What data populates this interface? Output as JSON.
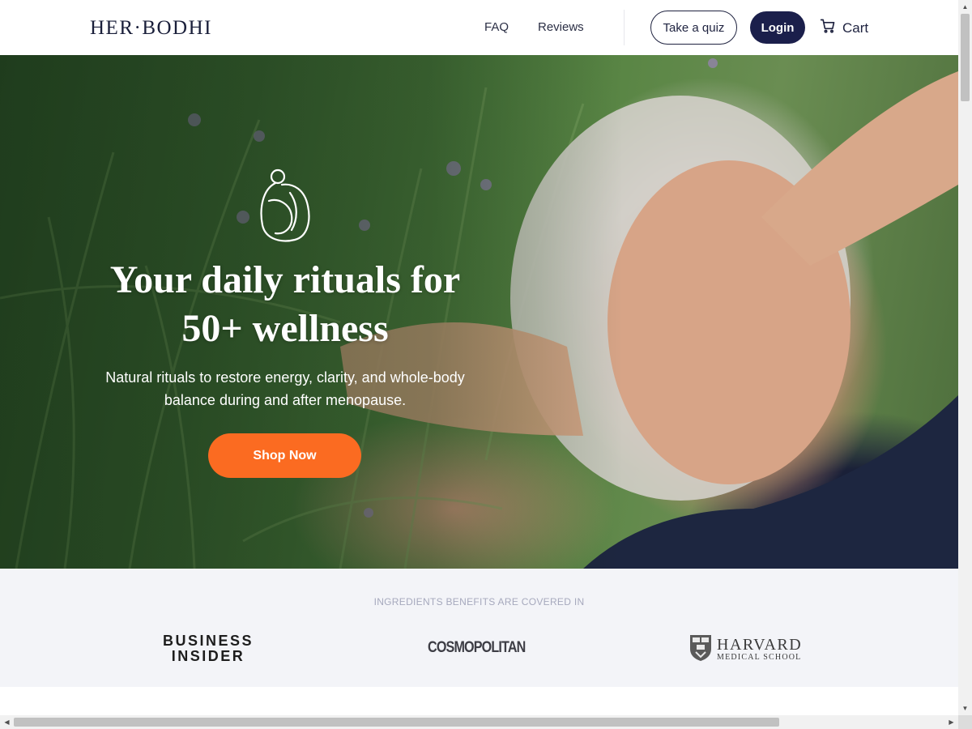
{
  "header": {
    "logo": "HER·BODHI",
    "nav": {
      "faq": "FAQ",
      "reviews": "Reviews"
    },
    "take_quiz": "Take a quiz",
    "login": "Login",
    "cart": "Cart",
    "cart_icon": "cart-icon"
  },
  "hero": {
    "emblem_icon": "woman-silhouette-icon",
    "title_line1": "Your daily rituals for",
    "title_line2": "50+ wellness",
    "subtitle_line1": "Natural rituals to restore energy, clarity, and whole-body",
    "subtitle_line2": "balance during and after menopause.",
    "cta": "Shop Now",
    "cta_color": "#fb6b21"
  },
  "press": {
    "caption": "INGREDIENTS BENEFITS ARE COVERED IN",
    "logos": {
      "business_insider_line1": "BUSINESS",
      "business_insider_line2": "INSIDER",
      "cosmopolitan": "COSMOPOLITAN",
      "harvard_name": "HARVARD",
      "harvard_school": "MEDICAL SCHOOL"
    }
  },
  "colors": {
    "brand_navy": "#1b1f4b",
    "press_bg": "#f3f4f8"
  }
}
